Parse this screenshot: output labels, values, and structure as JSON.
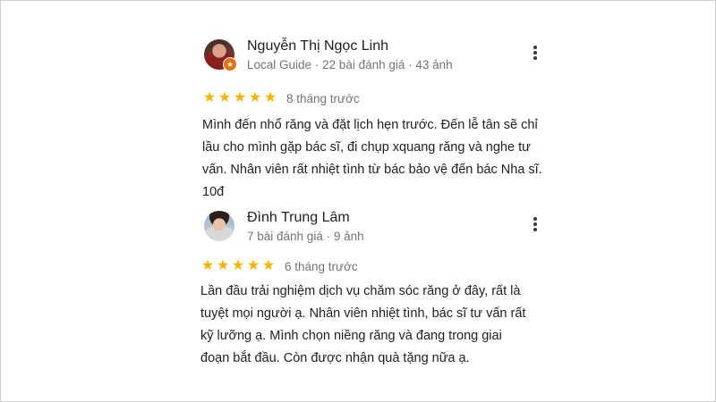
{
  "reviews": [
    {
      "name": "Nguyễn Thị Ngọc Linh",
      "meta": "Local Guide · 22 bài đánh giá · 43 ảnh",
      "rating": 5,
      "stars": [
        "★",
        "★",
        "★",
        "★",
        "★"
      ],
      "date": "8 tháng trước",
      "text": "Mình đến nhổ răng và đặt lịch hẹn trước. Đến lễ tân sẽ chỉ lầu cho mình gặp bác sĩ, đi chụp xquang răng và nghe tư vấn. Nhân viên rất nhiệt tình từ bác bảo vệ đến bác Nha sĩ. 10đ",
      "local_guide_badge": "★"
    },
    {
      "name": "Đình Trung Lâm",
      "meta": "7 bài đánh giá · 9 ảnh",
      "rating": 5,
      "stars": [
        "★",
        "★",
        "★",
        "★",
        "★"
      ],
      "date": "6 tháng trước",
      "text": "Lần đầu trải nghiệm dịch vụ chăm sóc răng ở đây, rất là tuyệt mọi người ạ. Nhân viên nhiệt tình, bác sĩ tư vấn rất kỹ lưỡng ạ. Mình chọn niềng răng và đang trong giai đoạn bắt đầu. Còn được nhận quà tặng nữa ạ."
    }
  ],
  "colors": {
    "star": "#f4b400",
    "secondary_text": "#70757a",
    "badge": "#e8710a"
  }
}
